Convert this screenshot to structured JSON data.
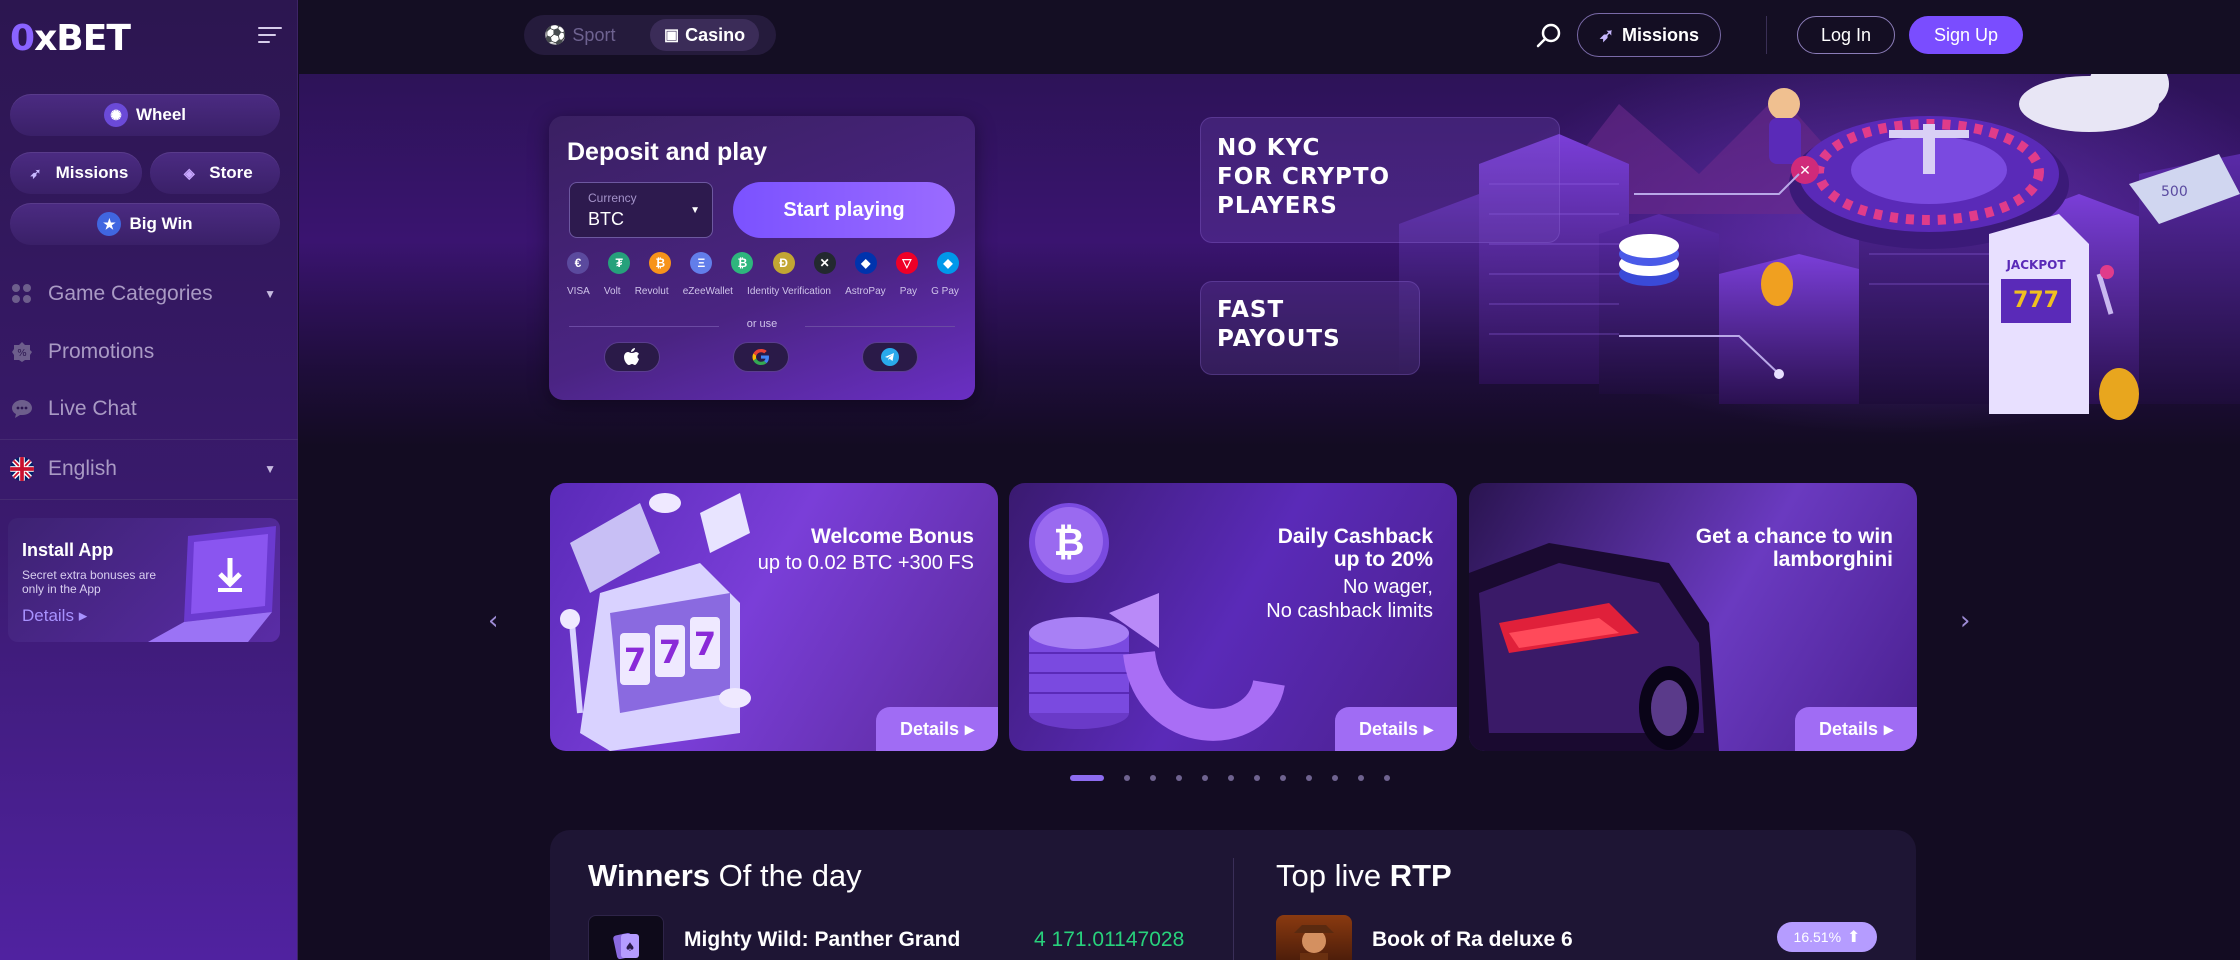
{
  "logo": {
    "first": "0",
    "rest": "xBET"
  },
  "sidebar": {
    "wheel": "Wheel",
    "missions": "Missions",
    "store": "Store",
    "big_win": "Big Win",
    "nav": [
      {
        "label": "Game Categories"
      },
      {
        "label": "Promotions"
      },
      {
        "label": "Live Chat"
      },
      {
        "label": "English"
      }
    ],
    "install": {
      "title": "Install App",
      "text": "Secret extra bonuses are only in the App",
      "details": "Details"
    }
  },
  "topbar": {
    "sport": "Sport",
    "casino": "Casino",
    "missions": "Missions",
    "login": "Log In",
    "signup": "Sign Up"
  },
  "deposit": {
    "title": "Deposit and play",
    "currency_label": "Currency",
    "currency_value": "BTC",
    "start": "Start playing",
    "coins": [
      {
        "sym": "€",
        "color": "#5b4a9e"
      },
      {
        "sym": "₮",
        "color": "#26a17b"
      },
      {
        "sym": "₿",
        "color": "#f7931a"
      },
      {
        "sym": "Ξ",
        "color": "#627eea"
      },
      {
        "sym": "₿",
        "color": "#2eb67d"
      },
      {
        "sym": "Ð",
        "color": "#c2a633"
      },
      {
        "sym": "✕",
        "color": "#23292f"
      },
      {
        "sym": "◆",
        "color": "#0033ad"
      },
      {
        "sym": "▽",
        "color": "#ef0027"
      },
      {
        "sym": "◆",
        "color": "#0098ea"
      }
    ],
    "payments": [
      "VISA",
      "Volt",
      "Revolut",
      "eZeeWallet",
      "Identity Verification",
      "AstroPay",
      "Pay",
      "G Pay"
    ],
    "or_use": "or use"
  },
  "hero": {
    "promo1": [
      "NO KYC",
      "FOR CRYPTO",
      "PLAYERS"
    ],
    "promo2": [
      "FAST",
      "PAYOUTS"
    ],
    "jackpot": "JACKPOT",
    "banknote": "500"
  },
  "cards": [
    {
      "title": "Welcome Bonus",
      "sub": "up to 0.02 BTC +300 FS",
      "details": "Details"
    },
    {
      "title_lines": [
        "Daily Cashback",
        "up to 20%"
      ],
      "sub_lines": [
        "No wager,",
        "No cashback limits"
      ],
      "details": "Details"
    },
    {
      "title_lines": [
        "Get a chance to win",
        "lamborghini"
      ],
      "details": "Details"
    }
  ],
  "winners": {
    "title_bold": "Winners",
    "title_rest": " Of the day",
    "game": "Mighty Wild: Panther Grand",
    "amount": "4 171.01147028"
  },
  "rtp": {
    "title_plain": "Top live ",
    "title_bold": "RTP",
    "game": "Book of Ra deluxe 6",
    "value": "16.51%"
  },
  "colors": {
    "accent": "#7a4dff",
    "green": "#28d17c",
    "bg": "#130c22"
  }
}
